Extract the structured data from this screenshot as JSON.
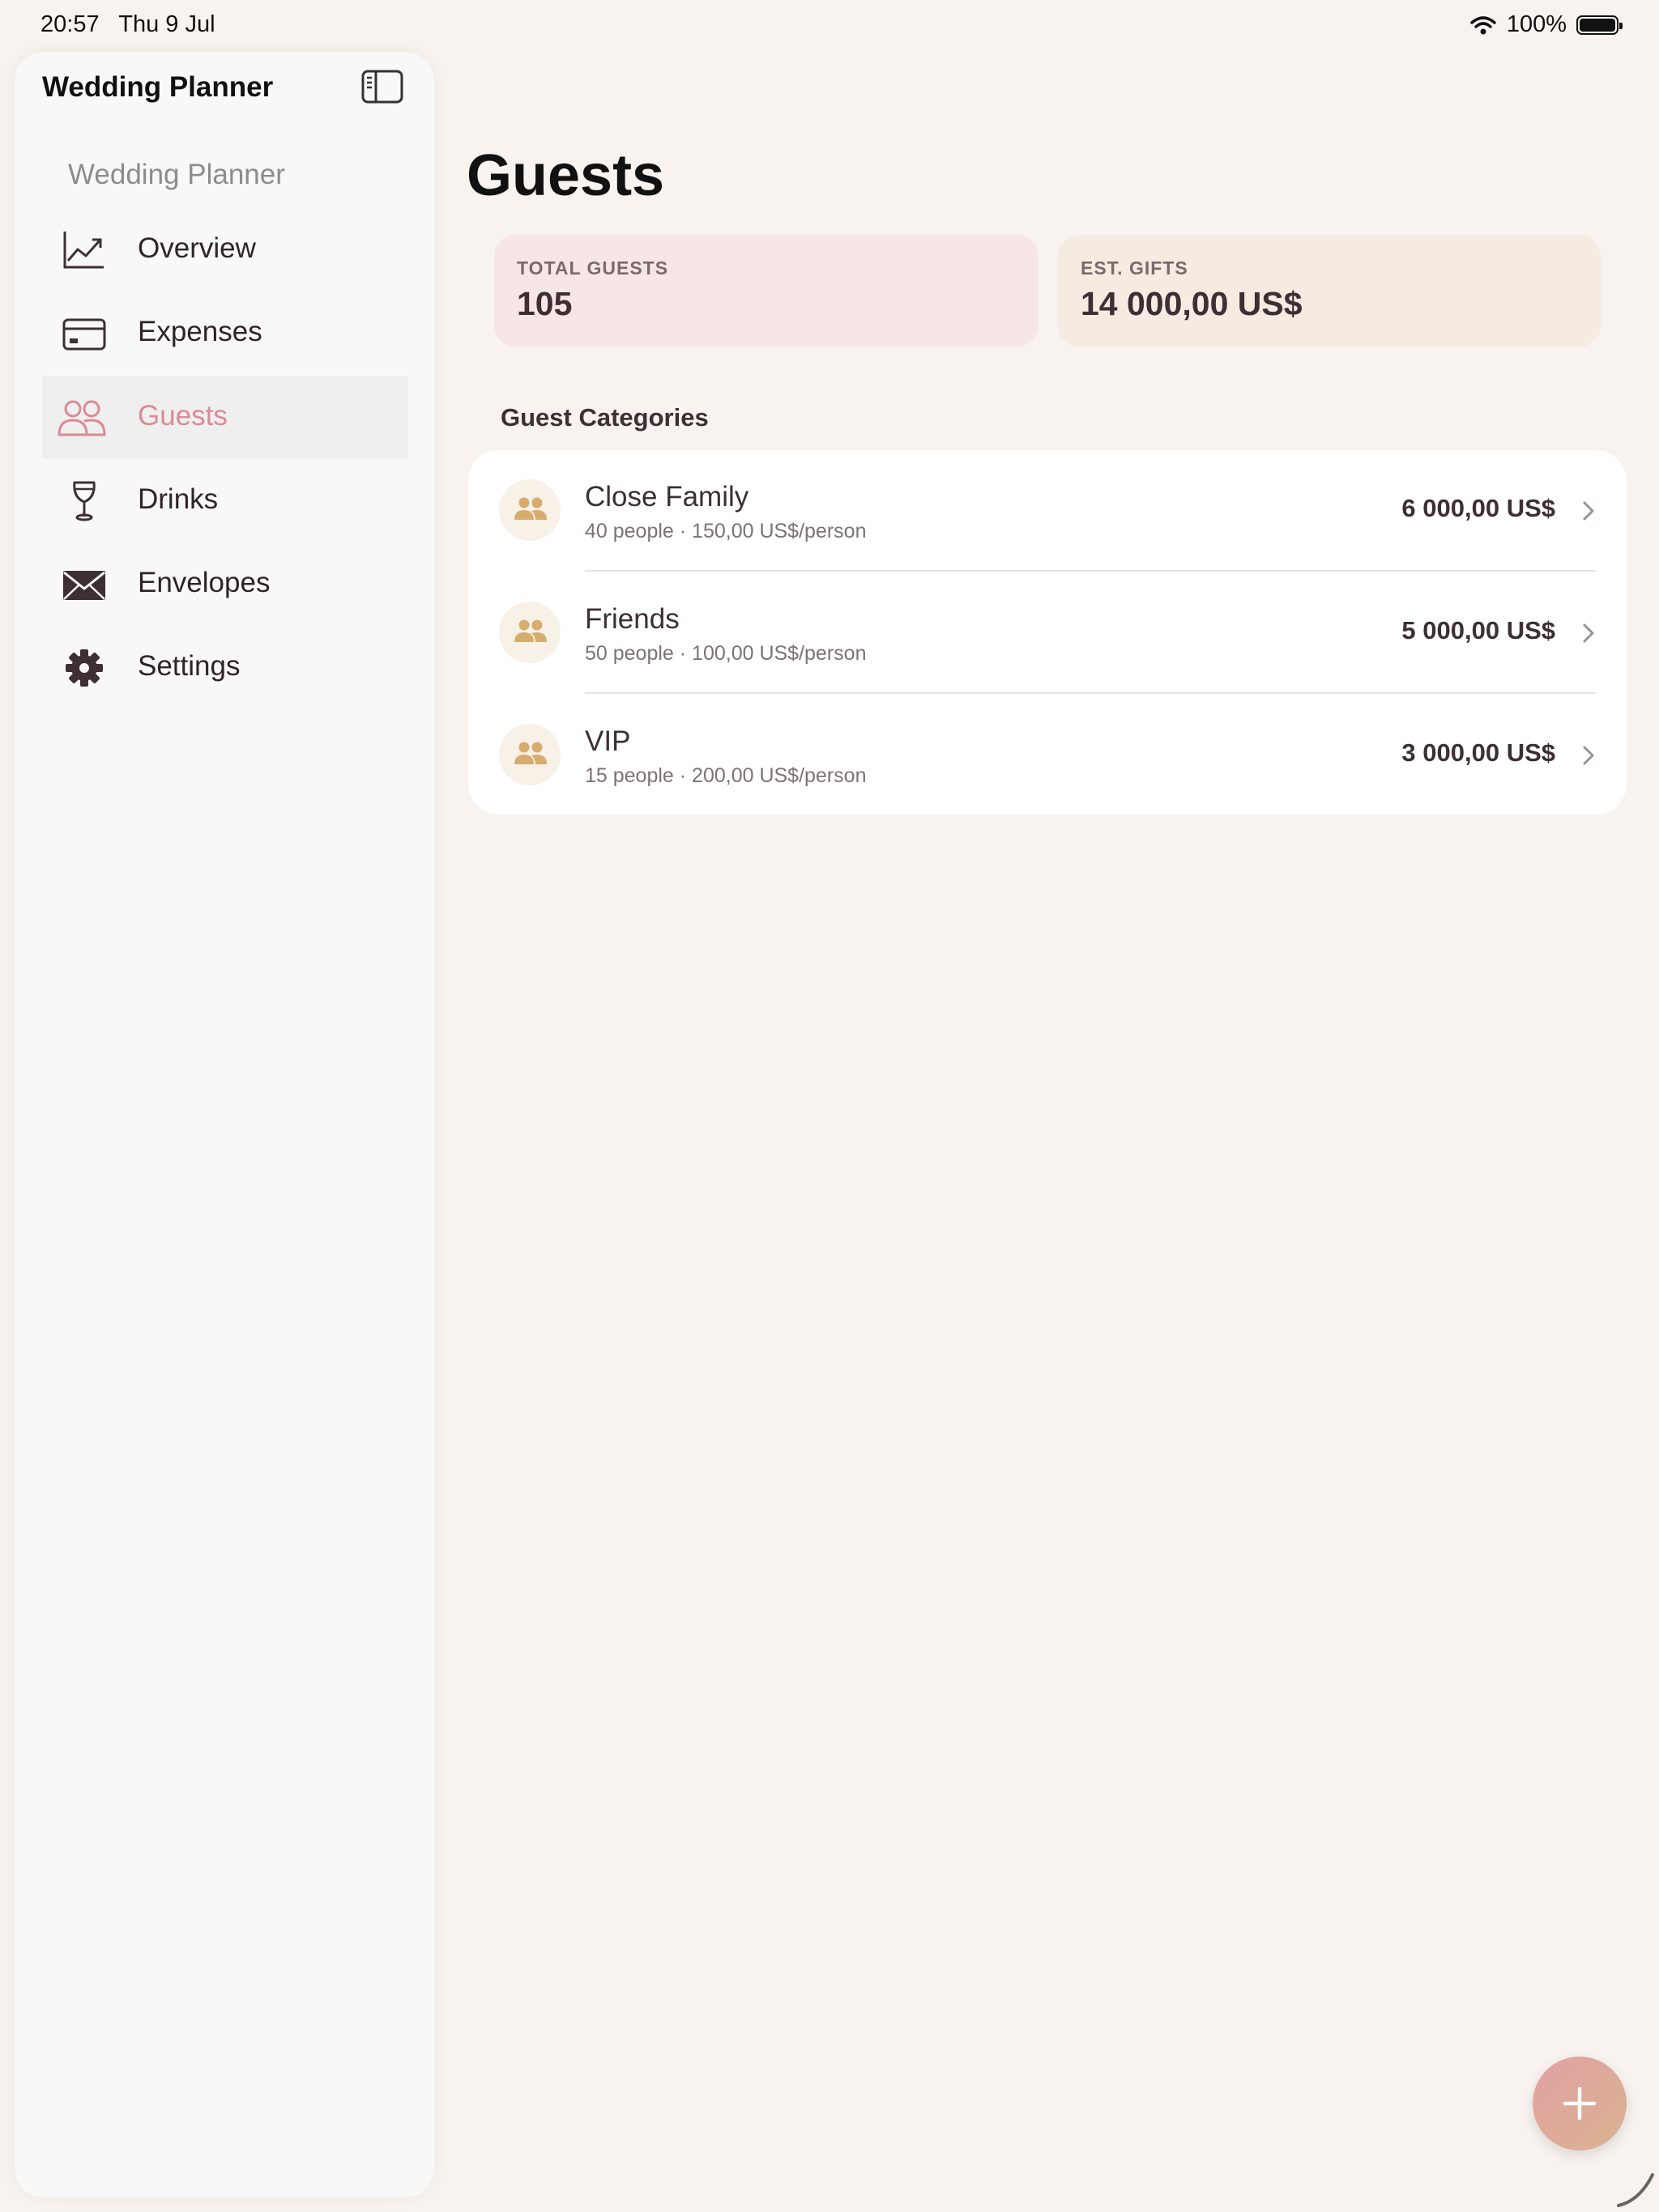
{
  "status_bar": {
    "time": "20:57",
    "date": "Thu 9 Jul",
    "battery": "100%"
  },
  "sidebar": {
    "title": "Wedding Planner",
    "section_label": "Wedding Planner",
    "items": [
      {
        "label": "Overview",
        "icon": "chart-line-icon",
        "selected": false
      },
      {
        "label": "Expenses",
        "icon": "credit-card-icon",
        "selected": false
      },
      {
        "label": "Guests",
        "icon": "people-icon",
        "selected": true
      },
      {
        "label": "Drinks",
        "icon": "wine-glass-icon",
        "selected": false
      },
      {
        "label": "Envelopes",
        "icon": "envelope-icon",
        "selected": false
      },
      {
        "label": "Settings",
        "icon": "gear-icon",
        "selected": false
      }
    ]
  },
  "main": {
    "title": "Guests",
    "stats": {
      "total_guests_label": "TOTAL GUESTS",
      "total_guests_value": "105",
      "gifts_label": "EST. GIFTS",
      "gifts_value": "14 000,00 US$"
    },
    "categories_title": "Guest Categories",
    "categories": [
      {
        "name": "Close Family",
        "detail": "40 people · 150,00 US$/person",
        "amount": "6 000,00 US$"
      },
      {
        "name": "Friends",
        "detail": "50 people · 100,00 US$/person",
        "amount": "5 000,00 US$"
      },
      {
        "name": "VIP",
        "detail": "15 people · 200,00 US$/person",
        "amount": "3 000,00 US$"
      }
    ]
  },
  "colors": {
    "accent": "#d98b94",
    "background": "#f8f3ef",
    "guests_card": "#f6e7e6",
    "gifts_card": "#f5ebe0",
    "avatar_icon": "#d6ad6f"
  }
}
